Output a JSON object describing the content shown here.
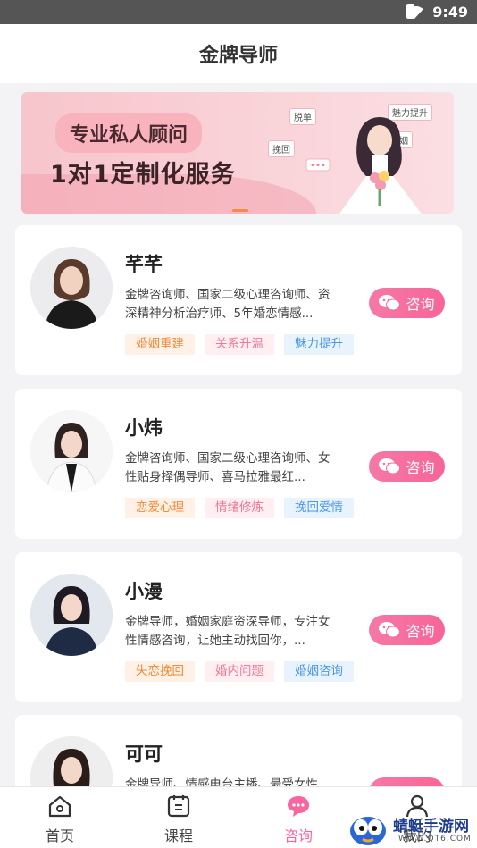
{
  "status": {
    "time": "9:49"
  },
  "header": {
    "title": "金牌导师"
  },
  "banner": {
    "slogan_pill": "专业私人顾问",
    "slogan_main": "1对1定制化服务",
    "chips": [
      "脱单",
      "魅力提升",
      "挽回",
      "婚姻"
    ]
  },
  "mentors": [
    {
      "name": "芊芊",
      "desc": "金牌咨询师、国家二级心理咨询师、资深精神分析治疗师、5年婚恋情感...",
      "tags": [
        "婚姻重建",
        "关系升温",
        "魅力提升"
      ],
      "button": "咨询"
    },
    {
      "name": "小炜",
      "desc": "金牌咨询师、国家二级心理咨询师、女性贴身择偶导师、喜马拉雅最红...",
      "tags": [
        "恋爱心理",
        "情绪修炼",
        "挽回爱情"
      ],
      "button": "咨询"
    },
    {
      "name": "小漫",
      "desc": "金牌导师，婚姻家庭资深导师，专注女性情感咨询，让她主动找回你，...",
      "tags": [
        "失恋挽回",
        "婚内问题",
        "婚姻咨询"
      ],
      "button": "咨询"
    },
    {
      "name": "可可",
      "desc": "金牌导师、情感电台主播、最受女性",
      "tags": [],
      "button": "咨询"
    }
  ],
  "tabbar": {
    "items": [
      {
        "label": "首页",
        "icon": "home-icon"
      },
      {
        "label": "课程",
        "icon": "course-icon"
      },
      {
        "label": "咨询",
        "icon": "chat-bubble-icon",
        "active": true
      },
      {
        "label": "我的",
        "icon": "user-icon"
      }
    ]
  },
  "watermark": {
    "title": "蜻蜓手游网",
    "url": "WWW.QT6.COM"
  },
  "colors": {
    "accent": "#f766a0",
    "tag_orange": "#f08a3a",
    "tag_pink": "#f07896",
    "tag_blue": "#4a97e6"
  }
}
